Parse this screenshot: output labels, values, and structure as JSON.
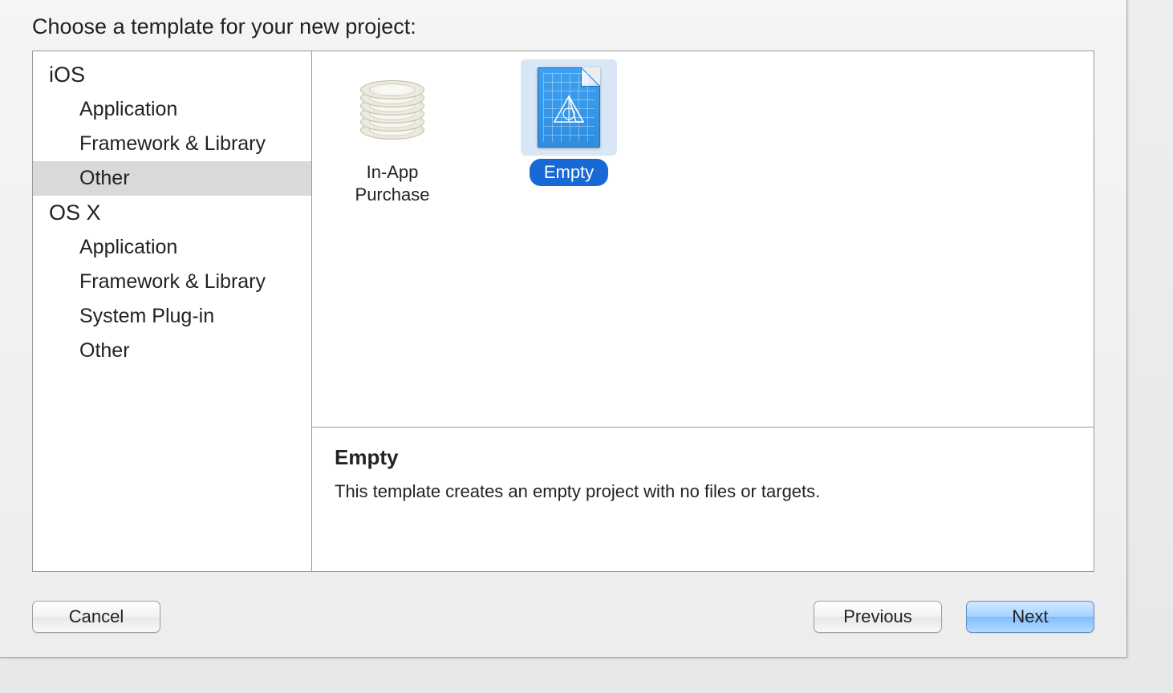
{
  "header": {
    "title": "Choose a template for your new project:"
  },
  "sidebar": {
    "sections": [
      {
        "heading": "iOS",
        "items": [
          {
            "label": "Application",
            "selected": false
          },
          {
            "label": "Framework & Library",
            "selected": false
          },
          {
            "label": "Other",
            "selected": true
          }
        ]
      },
      {
        "heading": "OS X",
        "items": [
          {
            "label": "Application",
            "selected": false
          },
          {
            "label": "Framework & Library",
            "selected": false
          },
          {
            "label": "System Plug-in",
            "selected": false
          },
          {
            "label": "Other",
            "selected": false
          }
        ]
      }
    ]
  },
  "templates": [
    {
      "icon": "coins-icon",
      "label": "In-App Purchase",
      "selected": false
    },
    {
      "icon": "blueprint-icon",
      "label": "Empty",
      "selected": true
    }
  ],
  "description": {
    "title": "Empty",
    "text": "This template creates an empty project with no files or targets."
  },
  "buttons": {
    "cancel": "Cancel",
    "previous": "Previous",
    "next": "Next"
  }
}
